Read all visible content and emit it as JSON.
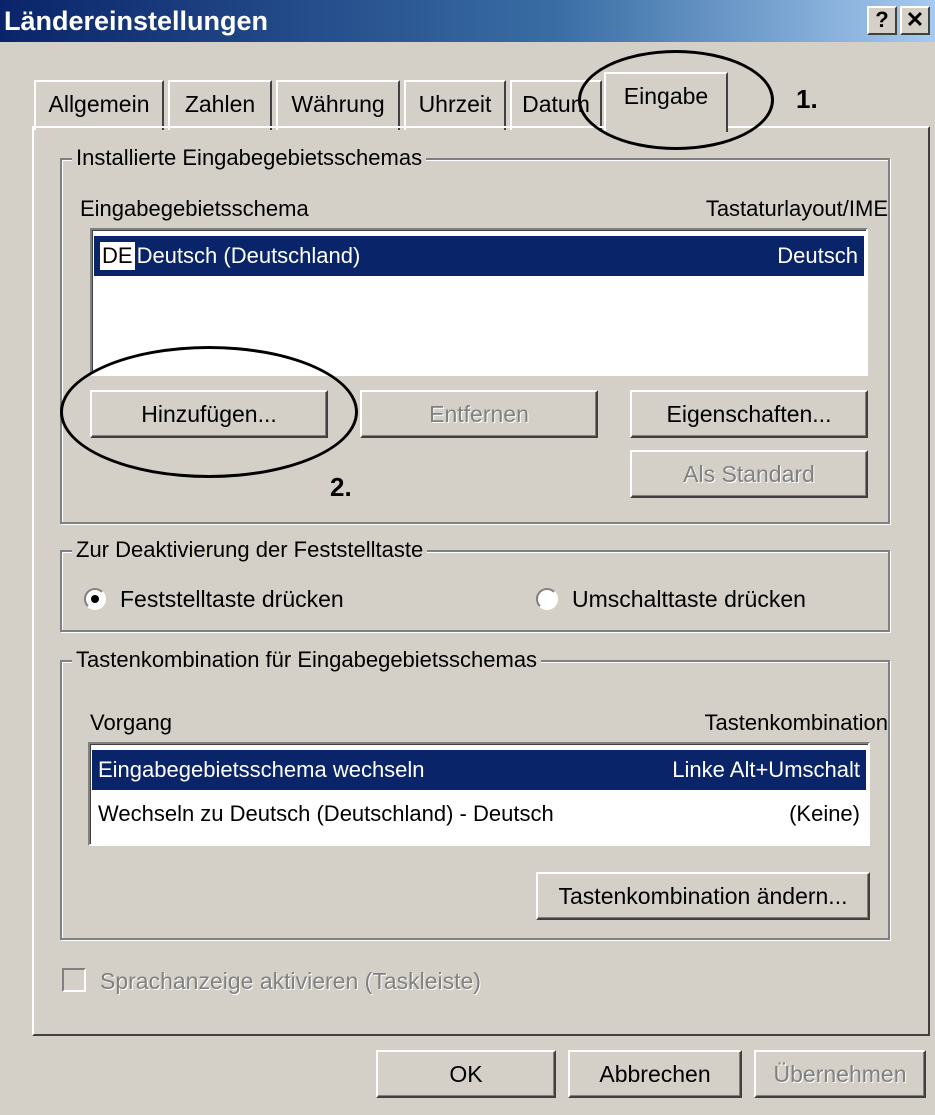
{
  "window": {
    "title": "Ländereinstellungen",
    "help_label": "?",
    "close_label": "✕"
  },
  "tabs": [
    {
      "label": "Allgemein"
    },
    {
      "label": "Zahlen"
    },
    {
      "label": "Währung"
    },
    {
      "label": "Uhrzeit"
    },
    {
      "label": "Datum"
    },
    {
      "label": "Eingabe",
      "active": true
    }
  ],
  "installed_group": {
    "legend": "Installierte Eingabegebietsschemas",
    "col_schema": "Eingabegebietsschema",
    "col_layout": "Tastaturlayout/IME",
    "items": [
      {
        "code": "DE",
        "name": "Deutsch (Deutschland)",
        "layout": "Deutsch",
        "selected": true
      }
    ],
    "add_button": "Hinzufügen...",
    "remove_button": "Entfernen",
    "properties_button": "Eigenschaften...",
    "default_button": "Als Standard"
  },
  "capslock_group": {
    "legend": "Zur Deaktivierung der Feststelltaste",
    "option_caps": "Feststelltaste drücken",
    "option_shift": "Umschalttaste drücken",
    "selected": "option_caps"
  },
  "hotkey_group": {
    "legend": "Tastenkombination für Eingabegebietsschemas",
    "col_action": "Vorgang",
    "col_keys": "Tastenkombination",
    "rows": [
      {
        "action": "Eingabegebietsschema wechseln",
        "keys": "Linke Alt+Umschalt",
        "selected": true
      },
      {
        "action": "Wechseln zu Deutsch (Deutschland) - Deutsch",
        "keys": "(Keine)",
        "selected": false
      }
    ],
    "change_button": "Tastenkombination ändern..."
  },
  "language_bar_checkbox": {
    "label": "Sprachanzeige aktivieren (Taskleiste)",
    "checked": false,
    "enabled": false
  },
  "footer": {
    "ok": "OK",
    "cancel": "Abbrechen",
    "apply": "Übernehmen"
  },
  "annotations": {
    "step1": "1.",
    "step2": "2."
  },
  "colors": {
    "title_start": "#0a246a",
    "title_end": "#a6caf0",
    "selection": "#0a246a",
    "face": "#d4d0c8"
  }
}
